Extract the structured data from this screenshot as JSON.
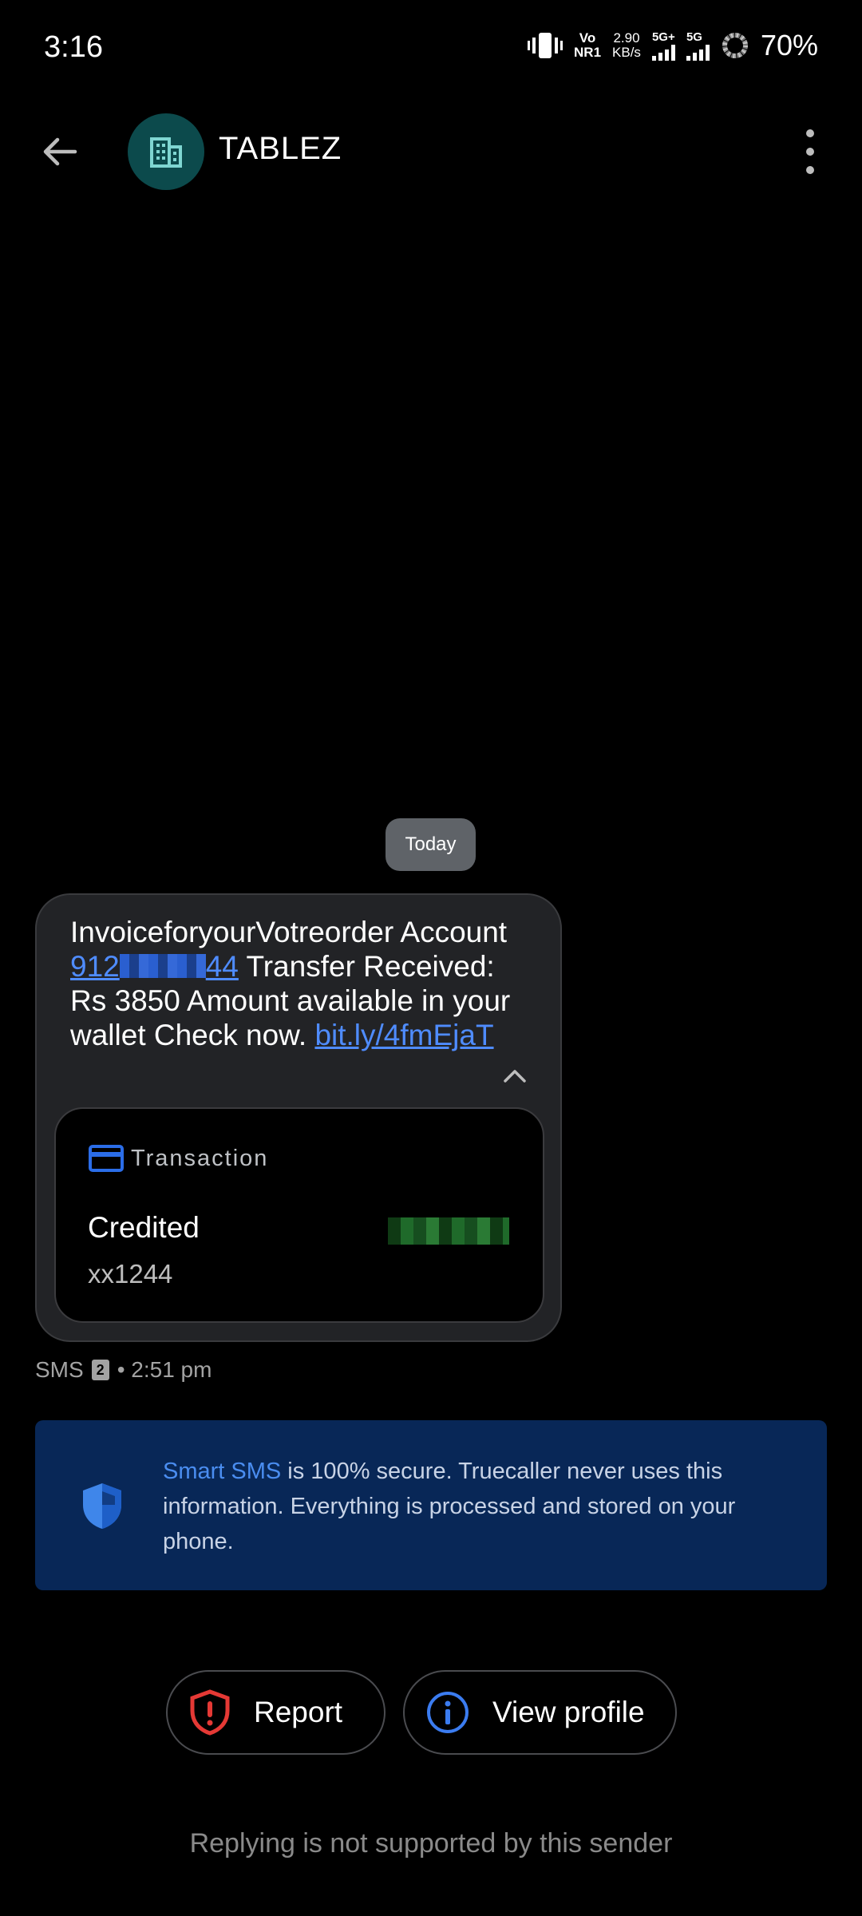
{
  "status_bar": {
    "time": "3:16",
    "volte_top": "Vo",
    "volte_bottom": "NR1",
    "speed_value": "2.90",
    "speed_unit": "KB/s",
    "net1": "5G+",
    "net2": "5G",
    "battery": "70%"
  },
  "header": {
    "title": "TABLEZ"
  },
  "date_chip": "Today",
  "message": {
    "text_before_account": "InvoiceforyourVotreorder Account ",
    "account_start": "912",
    "account_end": "44",
    "text_middle": " Transfer Received: Rs 3850 Amount available in your wallet Check now. ",
    "link": "bit.ly/4fmEjaT"
  },
  "transaction": {
    "label": "Transaction",
    "status": "Credited",
    "account": "xx1244"
  },
  "meta": {
    "type": "SMS",
    "sim": "2",
    "time": "• 2:51 pm"
  },
  "info": {
    "accent": "Smart SMS",
    "text": " is 100% secure. Truecaller never uses this information. Everything is processed and stored on your phone."
  },
  "actions": {
    "report": "Report",
    "view_profile": "View profile"
  },
  "footer": "Replying is not supported by this sender",
  "colors": {
    "link": "#4f8cff",
    "info_bg": "#082757",
    "report_icon": "#e53935",
    "profile_icon": "#3b7cf0"
  }
}
